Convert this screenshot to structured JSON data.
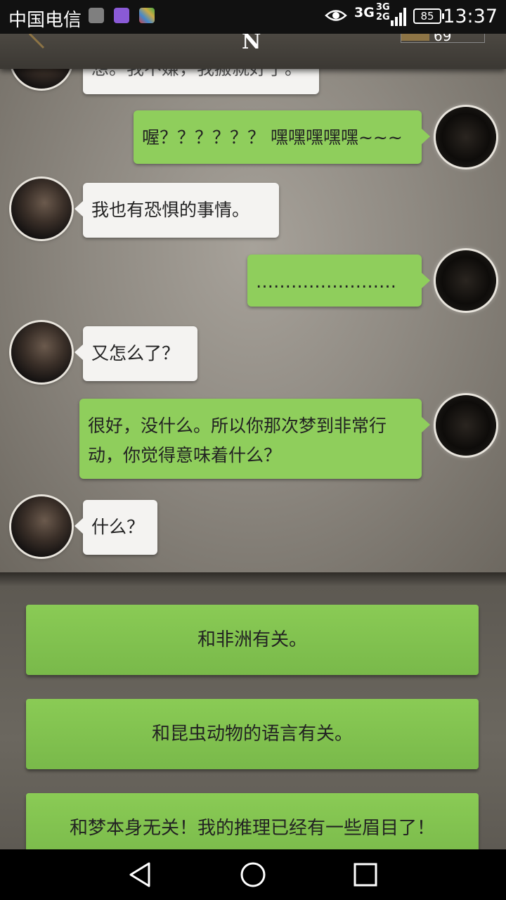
{
  "status_bar": {
    "carrier": "中国电信",
    "network": "3G",
    "signal_small": "3G\n2G",
    "battery": "85",
    "time": "13:37"
  },
  "header": {
    "title": "N",
    "score": "69"
  },
  "messages": [
    {
      "side": "left",
      "text": "想。我不嫌，我搬就好了。"
    },
    {
      "side": "right",
      "text": "喔？？？？？？ 嘿嘿嘿嘿嘿~~~"
    },
    {
      "side": "left",
      "text": "我也有恐惧的事情。"
    },
    {
      "side": "right",
      "text": "……………………"
    },
    {
      "side": "left",
      "text": "又怎么了？"
    },
    {
      "side": "right",
      "text": "很好，没什么。所以你那次梦到非常行动，你觉得意味着什么？"
    },
    {
      "side": "left",
      "text": "什么？"
    }
  ],
  "options": [
    {
      "label": "和非洲有关。"
    },
    {
      "label": "和昆虫动物的语言有关。"
    },
    {
      "label": "和梦本身无关！我的推理已经有一些眉目了！"
    }
  ],
  "colors": {
    "bubble_green": "#8fce5c",
    "bubble_white": "#f4f3f1",
    "option_green": "#8acb55"
  },
  "icons": {
    "back": "back-arrow-icon",
    "home": "home-circle-icon",
    "recents": "recents-square-icon"
  }
}
